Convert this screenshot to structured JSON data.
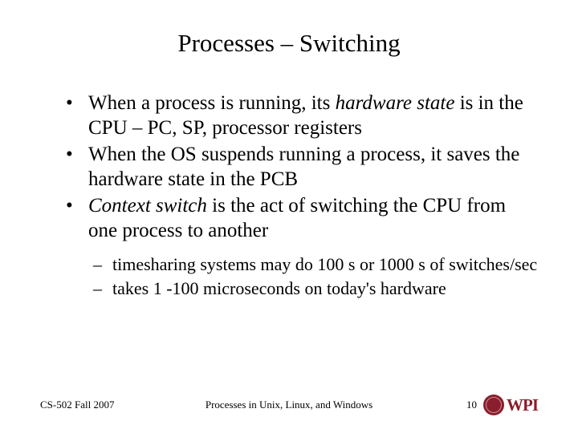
{
  "title": "Processes – Switching",
  "bullets": [
    {
      "pre": "When a process is running, its ",
      "em": "hardware state",
      "post": " is in the CPU – PC, SP, processor registers"
    },
    {
      "pre": "When the OS suspends running a process, it saves the hardware state in the PCB",
      "em": "",
      "post": ""
    },
    {
      "pre": "",
      "em": "Context switch",
      "post": " is the act of switching the CPU from one process to another"
    }
  ],
  "sub_bullets": [
    "timesharing systems may do 100 s or 1000 s of switches/sec",
    "takes 1 -100 microseconds on today's hardware"
  ],
  "footer": {
    "left": "CS-502 Fall 2007",
    "center": "Processes in Unix, Linux, and Windows",
    "page": "10",
    "logo_text": "WPI"
  }
}
